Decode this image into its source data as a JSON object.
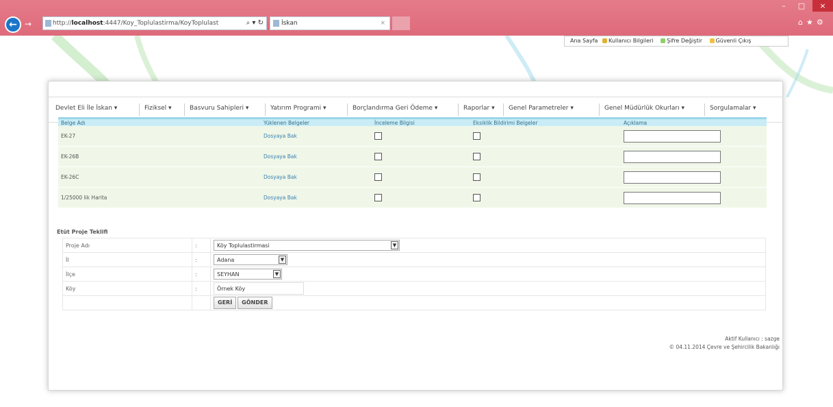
{
  "browser": {
    "url_prefix": "http://",
    "url_host": "localhost",
    "url_path": ":4447/Koy_Toplulastirma/KoyToplulast",
    "url_tools": "⌕ ▾ ↻",
    "tab_title": "İskan",
    "tab_close": "×",
    "win_min": "–",
    "win_max": "□",
    "win_close": "×",
    "right_tools": "⌂★⚙"
  },
  "top_links": {
    "home": "Ana Sayfa",
    "user_info": "Kullanıcı Bilgileri",
    "change_password": "Şifre Değiştir",
    "logout": "Güvenli Çıkış"
  },
  "menu": [
    "Devlet Eli İle İskan ▾",
    "Fiziksel ▾",
    "Basvuru Sahipleri ▾",
    "Yatırım Programi ▾",
    "Borçlandırma Geri Ödeme ▾",
    "Raporlar ▾",
    "Genel Parametreler ▾",
    "Genel Müdürlük Okurları ▾",
    "Sorgulamalar ▾"
  ],
  "doc_table": {
    "headers": [
      "Belge Adı",
      "Yüklenen Belgeler",
      "İnceleme Bilgisi",
      "Eksiklik Bildirimi Belgeler",
      "Açıklama"
    ],
    "rows": [
      {
        "name": "EK-27",
        "link": "Dosyaya Bak"
      },
      {
        "name": "EK-26B",
        "link": "Dosyaya Bak"
      },
      {
        "name": "EK-26C",
        "link": "Dosyaya Bak"
      },
      {
        "name": "1/25000 lik Harita",
        "link": "Dosyaya Bak"
      }
    ]
  },
  "form": {
    "section_title": "Etüt Proje Teklifi",
    "colon": ":",
    "project_label": "Proje Adı",
    "project_value": "Köy Toplulastirmasi",
    "il_label": "İl",
    "il_value": "Adana",
    "ilce_label": "İlçe",
    "ilce_value": "SEYHAN",
    "koy_label": "Köy",
    "koy_value": "Örnek Köy",
    "back_button": "GERİ",
    "submit_button": "GÖNDER"
  },
  "footer": {
    "active_user": "Aktif Kullanıcı : sazge",
    "copyright": "© 04.11.2014 Çevre ve Şehircilik Bakanlığı"
  },
  "colors": {
    "titlebar": "#de6a7a",
    "table_header": "#c9ecf6",
    "table_row": "#f0f7e8",
    "link": "#3a7fb0"
  }
}
